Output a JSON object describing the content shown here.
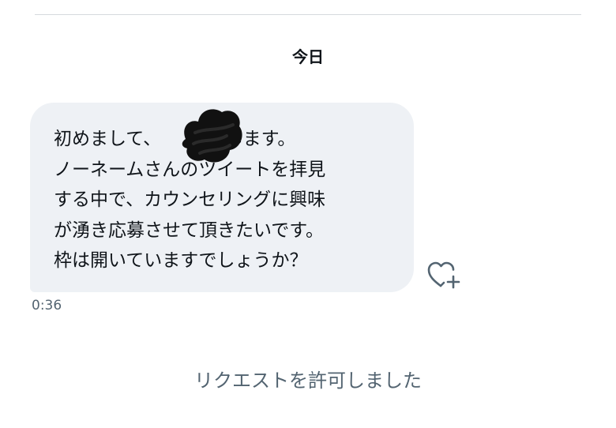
{
  "conversation": {
    "date_separator": "今日",
    "message": {
      "lines": [
        "初めまして、　　　申します。",
        "ノーネームさんのツイートを拝見",
        "する中で、カウンセリングに興味",
        "が湧き応募させて頂きたいです。",
        "枠は開いていますでしょうか？"
      ],
      "timestamp": "0:36"
    },
    "request_status": "リクエストを許可しました"
  },
  "icons": {
    "like": "heart-plus-icon",
    "redaction": "redaction-scribble"
  },
  "colors": {
    "bubble_background": "#eef1f5",
    "primary_text": "#0f1419",
    "secondary_text": "#536471",
    "divider": "#d5d9dd",
    "icon_stroke": "#536471"
  }
}
